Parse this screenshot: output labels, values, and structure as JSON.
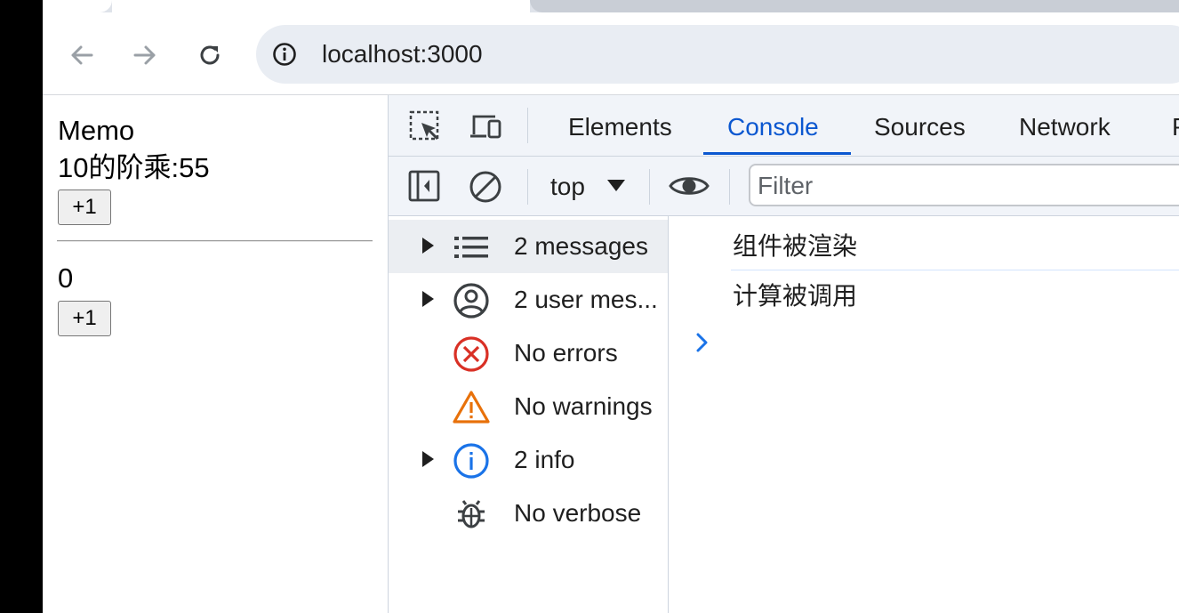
{
  "browser": {
    "url": "localhost:3000",
    "nav": {
      "back_icon": "arrow-left-icon",
      "forward_icon": "arrow-right-icon",
      "reload_icon": "reload-icon"
    }
  },
  "page": {
    "title": "Memo",
    "factorial_text": "10的阶乘:55",
    "button1_label": "+1",
    "count": "0",
    "button2_label": "+1"
  },
  "devtools": {
    "tabs": [
      {
        "label": "Elements",
        "active": false
      },
      {
        "label": "Console",
        "active": true
      },
      {
        "label": "Sources",
        "active": false
      },
      {
        "label": "Network",
        "active": false
      }
    ],
    "context": "top",
    "filter_placeholder": "Filter",
    "accent_color": "#0b57d0",
    "sidebar": [
      {
        "label": "2 messages",
        "icon": "list-icon",
        "expandable": true,
        "selected": true
      },
      {
        "label": "2 user mes...",
        "icon": "user-icon",
        "expandable": true,
        "selected": false
      },
      {
        "label": "No errors",
        "icon": "error-icon",
        "expandable": false,
        "selected": false
      },
      {
        "label": "No warnings",
        "icon": "warning-icon",
        "expandable": false,
        "selected": false
      },
      {
        "label": "2 info",
        "icon": "info-icon",
        "expandable": true,
        "selected": false
      },
      {
        "label": "No verbose",
        "icon": "bug-icon",
        "expandable": false,
        "selected": false
      }
    ],
    "console_logs": [
      "组件被渲染",
      "计算被调用"
    ]
  }
}
